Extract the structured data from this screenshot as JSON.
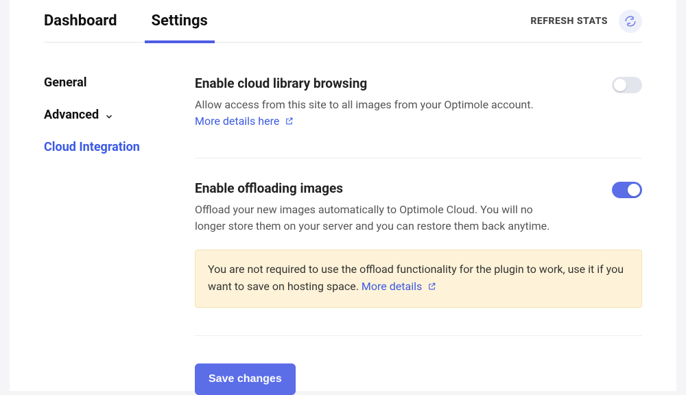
{
  "topbar": {
    "tabs": {
      "dashboard": "Dashboard",
      "settings": "Settings"
    },
    "refresh_label": "REFRESH STATS"
  },
  "sidebar": {
    "general": "General",
    "advanced": "Advanced",
    "cloud": "Cloud Integration"
  },
  "settings": {
    "cloud_library": {
      "title": "Enable cloud library browsing",
      "desc": "Allow access from this site to all images from your Optimole account.",
      "link": "More details here",
      "enabled": false
    },
    "offloading": {
      "title": "Enable offloading images",
      "desc": "Offload your new images automatically to Optimole Cloud. You will no longer store them on your server and you can restore them back anytime.",
      "enabled": true
    }
  },
  "notice": {
    "text": "You are not required to use the offload functionality for the plugin to work, use it if you want to save on hosting space. ",
    "link": "More details"
  },
  "actions": {
    "save": "Save changes"
  }
}
